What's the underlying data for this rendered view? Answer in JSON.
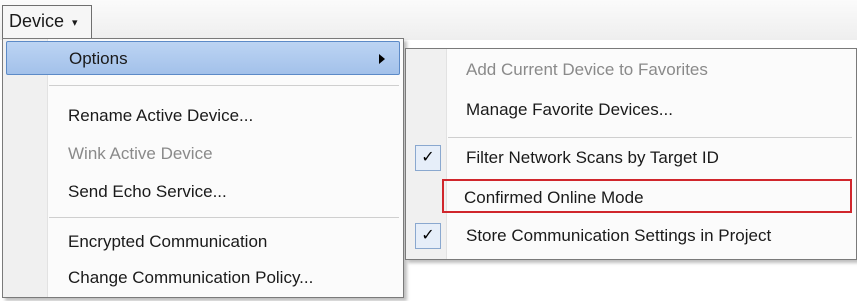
{
  "menubar": {
    "device_label": "Device",
    "chevron": "▾"
  },
  "device_menu": {
    "items": [
      {
        "label": "Options"
      },
      {
        "label": "Rename Active Device..."
      },
      {
        "label": "Wink Active Device"
      },
      {
        "label": "Send Echo Service..."
      },
      {
        "label": "Encrypted Communication"
      },
      {
        "label": "Change Communication Policy..."
      }
    ]
  },
  "options_menu": {
    "items": [
      {
        "label": "Add Current Device to Favorites"
      },
      {
        "label": "Manage Favorite Devices..."
      },
      {
        "label": "Filter Network Scans by Target ID",
        "check": "✓"
      },
      {
        "label": "Confirmed Online Mode"
      },
      {
        "label": "Store Communication Settings in Project",
        "check": "✓"
      }
    ]
  },
  "colors": {
    "highlight": "#a3c1ea",
    "outline_red": "#d0262c",
    "disabled_text": "#8a8a8a"
  }
}
